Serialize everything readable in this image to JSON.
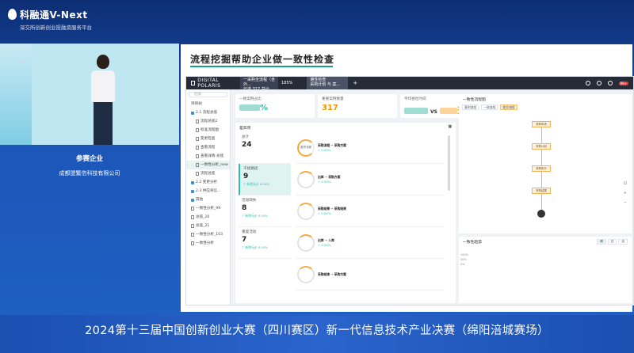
{
  "brand": {
    "title": "科融通V-Next",
    "subtitle": "深交所创新创业投融资服务平台"
  },
  "sponsor": {
    "label": "参赛企业",
    "name": "成都盟繁信科技有限公司"
  },
  "slide": {
    "title": "流程挖掘帮助企业做一致性检查"
  },
  "app": {
    "brand": "DIGITAL POLARIS",
    "tabs": [
      {
        "line1": "一采购全流程（含外...",
        "line2": "已选 317 共计 17.10K"
      },
      {
        "line1": "遵性检查",
        "line2": "采购计划 与 案..."
      }
    ],
    "tab_pct": "185%",
    "plus": "+",
    "badge": "99+"
  },
  "sidebar": {
    "search": "检索",
    "tree_label": "项目树",
    "items": [
      {
        "label": "2.1 流程总揽",
        "level": 1
      },
      {
        "label": "流程总揽2",
        "level": 2
      },
      {
        "label": "标准流程图",
        "level": 2
      },
      {
        "label": "变更检查",
        "level": 2
      },
      {
        "label": "查看流程",
        "level": 2
      },
      {
        "label": "查看详情-总揽",
        "level": 2
      },
      {
        "label": "一致性分析_new",
        "level": 2
      },
      {
        "label": "流程总揽",
        "level": 2
      },
      {
        "label": "2.2 变更分析",
        "level": 1
      },
      {
        "label": "2.3 供应商信...",
        "level": 1
      },
      {
        "label": "其他",
        "level": 1
      },
      {
        "label": "一致性分析_99",
        "level": 1
      },
      {
        "label": "总揽_20",
        "level": 1
      },
      {
        "label": "总揽_21",
        "level": 1
      },
      {
        "label": "一致性分析_103",
        "level": 1
      },
      {
        "label": "一致性分析",
        "level": 1
      }
    ]
  },
  "kpis": [
    {
      "label": "一致案例占比",
      "value_suffix": "%"
    },
    {
      "label": "重要案例数量",
      "value": "317"
    },
    {
      "label": "平均吞吐时间",
      "vs": "VS",
      "value_suffix": "天"
    }
  ],
  "detail": {
    "title": "差异项",
    "groups": [
      {
        "label": "总计",
        "count": "24",
        "sub": ""
      },
      {
        "label": "干扰路径",
        "count": "9",
        "sub": "↑ 新增无价 0.00%"
      },
      {
        "label": "活动缺失",
        "count": "8",
        "sub": "↑ 新增无价 0.00%"
      },
      {
        "label": "重复活动",
        "count": "7",
        "sub": "↑ 新增无价 0.00%"
      }
    ],
    "steps": [
      {
        "ring": "差异流程",
        "a": "采购流程",
        "b": "采购方案",
        "pct": "+ 0.00%"
      },
      {
        "ring": "",
        "a": "出库",
        "b": "采购方案",
        "pct": "+ 0.00%"
      },
      {
        "ring": "",
        "a": "采购结果",
        "b": "采购结果",
        "pct": "+ 0.00%"
      },
      {
        "ring": "",
        "a": "出库",
        "b": "入库",
        "pct": "+ 0.00%"
      },
      {
        "ring": "",
        "a": "采购结束",
        "b": "采购方案",
        "pct": ""
      }
    ]
  },
  "flow_panel": {
    "title": "一致性流程图",
    "filters": [
      "案例流程",
      "一致流程",
      "差异流程"
    ],
    "nodes": [
      "采购申请",
      "采购计划",
      "采购执行",
      "采购结果"
    ]
  },
  "trend": {
    "title": "一致性趋势",
    "segments": [
      "周",
      "日",
      "月"
    ],
    "y_labels": [
      "100%",
      "50%",
      "0%"
    ]
  },
  "banner": {
    "text": "2024第十三届中国创新创业大赛（四川赛区）新一代信息技术产业决赛（绵阳涪城赛场）"
  }
}
